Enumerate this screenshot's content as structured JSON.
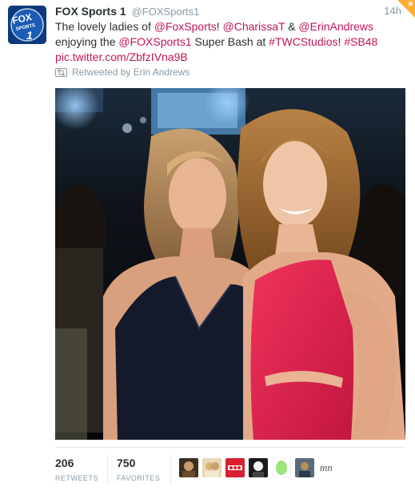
{
  "tweet": {
    "fullname": "FOX Sports 1",
    "username": "@FOXSports1",
    "timestamp": "14h",
    "text": {
      "t1": "The lovely ladies of ",
      "m1": "@FoxSports",
      "t2": "! ",
      "m2": "@CharissaT",
      "t3": " & ",
      "m3": "@ErinAndrews",
      "t4": " enjoying the ",
      "m4": "@FOXSports1",
      "t5": " Super Bash at ",
      "h1": "#TWCStudios",
      "t6": "! ",
      "h2": "#SB48",
      "link": "pic.twitter.com/ZbfzIVna9B"
    },
    "retweeted_by": "Retweeted by Erin Andrews"
  },
  "avatar": {
    "logo_line1": "FOX",
    "logo_line2": "SPORTS",
    "logo_number": "1"
  },
  "stats": {
    "retweets_count": "206",
    "retweets_label": "RETWEETS",
    "favorites_count": "750",
    "favorites_label": "FAVORITES"
  },
  "favoriters": {
    "avatar7_text": "mn"
  },
  "colors": {
    "link": "#c0155a",
    "muted": "#8899a6",
    "text": "#292f33",
    "star": "#ffac33",
    "dress_red": "#e0264f",
    "dress_navy": "#141a2b"
  },
  "icons": [
    "retweet-icon",
    "favorite-star-icon"
  ]
}
